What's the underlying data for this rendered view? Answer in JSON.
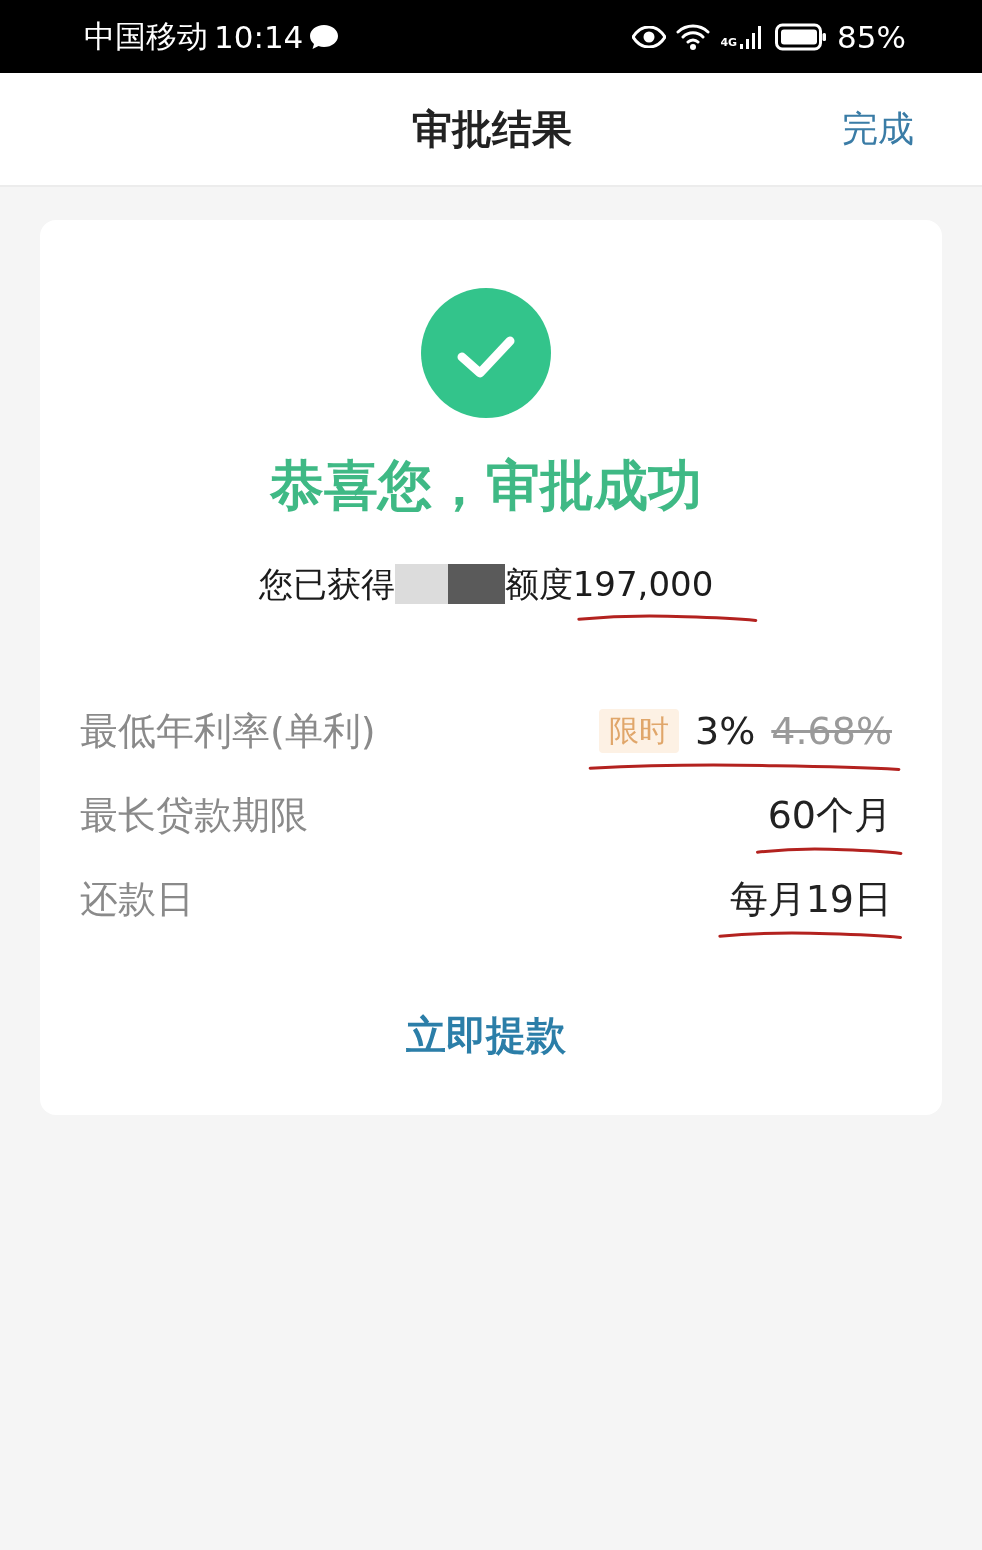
{
  "status_bar": {
    "carrier": "中国移动",
    "time": "10:14",
    "network": "4G",
    "battery": "85%"
  },
  "nav": {
    "title": "审批结果",
    "action": "完成"
  },
  "result": {
    "title": "恭喜您，审批成功",
    "sentence_start": "您已获得",
    "sentence_end": "额度",
    "amount": "197,000",
    "amount_underlined": true
  },
  "details": [
    {
      "kind": "rate",
      "label": "最低年利率(单利)",
      "tag": "限时",
      "value": "3%",
      "old_value": "4.68%",
      "underlined": true
    },
    {
      "kind": "plain",
      "label": "最长贷款期限",
      "value": "60个月",
      "underlined": true
    },
    {
      "kind": "plain",
      "label": "还款日",
      "value": "每月19日",
      "underlined": true
    }
  ],
  "action": {
    "label": "立即提款"
  }
}
